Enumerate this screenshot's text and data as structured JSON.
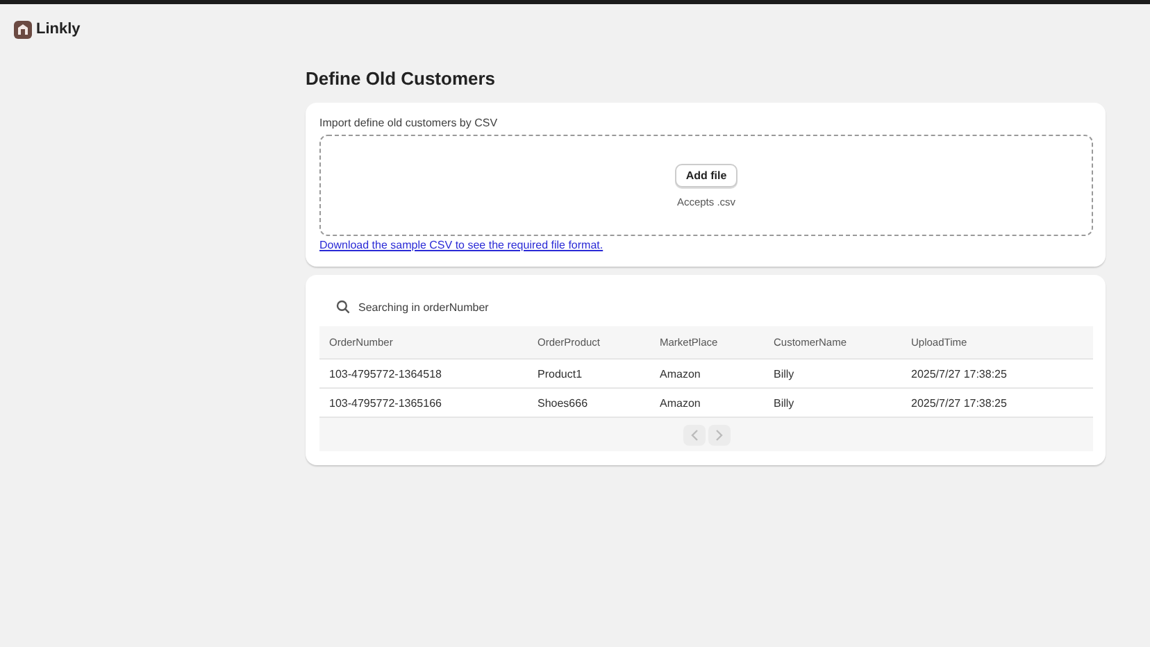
{
  "app": {
    "name": "Linkly"
  },
  "page": {
    "title": "Define Old Customers"
  },
  "import": {
    "label": "Import define old customers by CSV",
    "button": "Add file",
    "hint": "Accepts .csv",
    "link": "Download the sample CSV to see the required file format."
  },
  "search": {
    "placeholder": "Searching in orderNumber"
  },
  "table": {
    "columns": [
      "OrderNumber",
      "OrderProduct",
      "MarketPlace",
      "CustomerName",
      "UploadTime"
    ],
    "rows": [
      [
        "103-4795772-1364518",
        "Product1",
        "Amazon",
        "Billy",
        "2025/7/27 17:38:25"
      ],
      [
        "103-4795772-1365166",
        "Shoes666",
        "Amazon",
        "Billy",
        "2025/7/27 17:38:25"
      ]
    ]
  },
  "pagination": {
    "previous_disabled": true,
    "next_disabled": true
  }
}
